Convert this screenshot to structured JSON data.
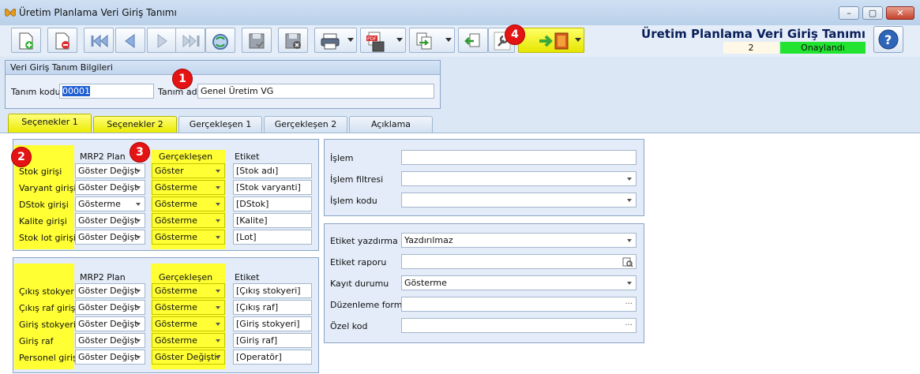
{
  "window": {
    "title": "Üretim Planlama Veri Giriş Tanımı"
  },
  "header": {
    "title": "Üretim Planlama Veri Giriş Tanımı",
    "status_number": "2",
    "status_label": "Onaylandı"
  },
  "callouts": {
    "c1": "1",
    "c2": "2",
    "c3": "3",
    "c4": "4"
  },
  "definition": {
    "group_title": "Veri Giriş Tanım Bilgileri",
    "code_label": "Tanım kodu",
    "code_value": "00001",
    "name_label": "Tanım adı",
    "name_value": "Genel Üretim VG"
  },
  "tabs": [
    "Seçenekler 1",
    "Seçenekler 2",
    "Gerçekleşen 1",
    "Gerçekleşen 2",
    "Açıklama"
  ],
  "grid1": {
    "headers": {
      "mrp2": "MRP2 Plan",
      "actual": "Gerçekleşen",
      "label": "Etiket"
    },
    "rows": [
      {
        "name": "Stok girişi",
        "mrp2": "Göster Değişt",
        "actual": "Göster",
        "label": "[Stok adı]"
      },
      {
        "name": "Varyant girişi",
        "mrp2": "Göster Değişt",
        "actual": "Gösterme",
        "label": "[Stok varyanti]"
      },
      {
        "name": "DStok girişi",
        "mrp2": "Gösterme",
        "actual": "Gösterme",
        "label": "[DStok]"
      },
      {
        "name": "Kalite girişi",
        "mrp2": "Göster Değişt",
        "actual": "Gösterme",
        "label": "[Kalite]"
      },
      {
        "name": "Stok lot girişi",
        "mrp2": "Göster Değişt",
        "actual": "Gösterme",
        "label": "[Lot]"
      }
    ]
  },
  "grid2": {
    "headers": {
      "mrp2": "MRP2 Plan",
      "actual": "Gerçekleşen",
      "label": "Etiket"
    },
    "rows": [
      {
        "name": "Çıkış stokyeri",
        "mrp2": "Göster Değişt",
        "actual": "Gösterme",
        "label": "[Çıkış stokyeri]"
      },
      {
        "name": "Çıkış raf giriş",
        "mrp2": "Göster Değişt",
        "actual": "Gösterme",
        "label": "[Çıkış raf]"
      },
      {
        "name": "Giriş stokyeri",
        "mrp2": "Göster Değişt",
        "actual": "Gösterme",
        "label": "[Giriş stokyeri]"
      },
      {
        "name": "Giriş raf",
        "mrp2": "Göster Değişt",
        "actual": "Gösterme",
        "label": "[Giriş raf]"
      },
      {
        "name": "Personel girişi",
        "mrp2": "Göster Değişt",
        "actual": "Göster Değiştir",
        "label": "[Operatör]"
      }
    ]
  },
  "process": {
    "islem_label": "İşlem",
    "islem_value": "",
    "filter_label": "İşlem filtresi",
    "filter_value": "",
    "code_label": "İşlem kodu",
    "code_value": ""
  },
  "label_settings": {
    "print_label": "Etiket yazdırma",
    "print_value": "Yazdırılmaz",
    "report_label": "Etiket raporu",
    "report_value": "",
    "record_label": "Kayıt durumu",
    "record_value": "Gösterme",
    "form_label": "Düzenleme formu",
    "form_value": "",
    "special_label": "Özel kod",
    "special_value": ""
  },
  "colors": {
    "highlight": "#ffff33",
    "status_ok": "#22e32f",
    "title_text": "#0a1f5a",
    "callout": "#e41414"
  }
}
